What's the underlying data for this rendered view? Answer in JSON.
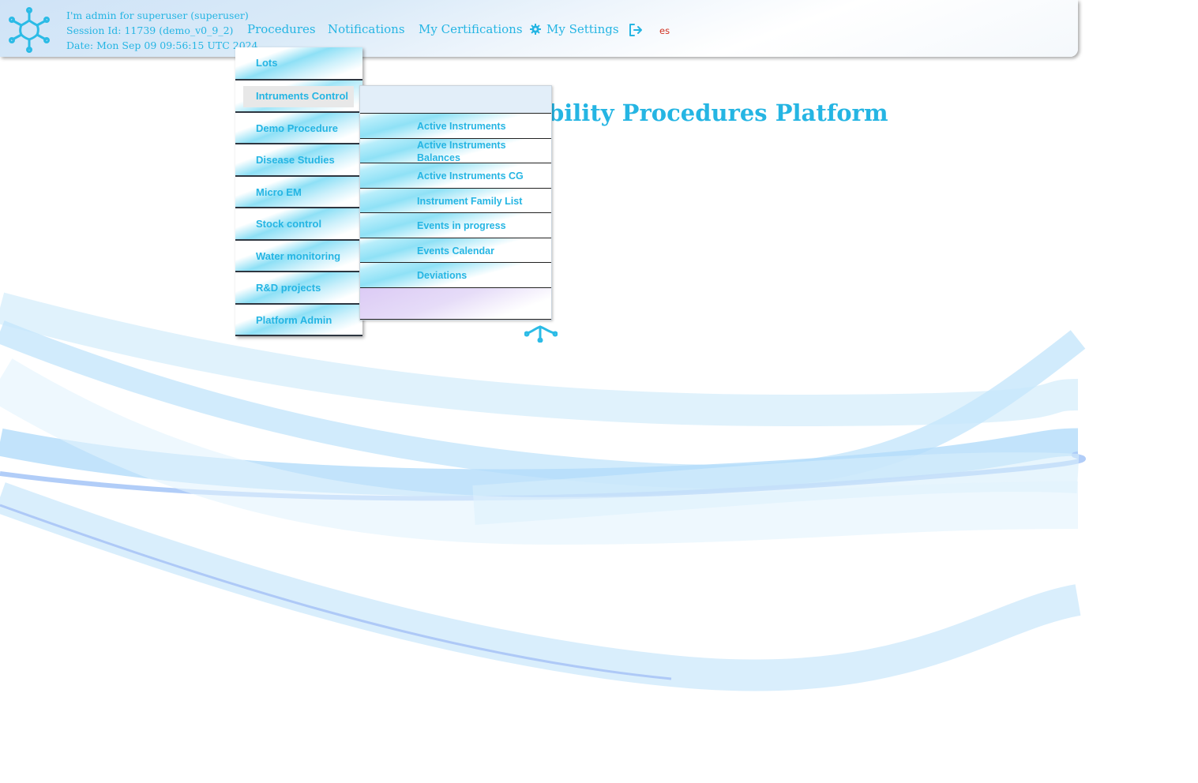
{
  "header": {
    "user_line": "I'm admin for superuser (superuser)",
    "session_line": "Session Id: 11739 (demo_v0_9_2)",
    "date_line": "Date: Mon Sep 09 09:56:15 UTC 2024",
    "nav": {
      "procedures": "Procedures",
      "notifications": "Notifications",
      "certifications": "My Certifications",
      "settings": "My Settings"
    },
    "language": "es"
  },
  "main": {
    "title": "bility Procedures Platform"
  },
  "procedures_menu": {
    "items": [
      {
        "label": "Lots"
      },
      {
        "label": "Intruments Control"
      },
      {
        "label": "Demo Procedure"
      },
      {
        "label": "Disease Studies"
      },
      {
        "label": "Micro EM"
      },
      {
        "label": "Stock control"
      },
      {
        "label": "Water monitoring"
      },
      {
        "label": "R&D projects"
      },
      {
        "label": "Platform Admin"
      }
    ],
    "active_item": "Intruments Control"
  },
  "instruments_submenu": {
    "items": [
      {
        "label": "Active Instruments"
      },
      {
        "label": "Active Instruments Balances"
      },
      {
        "label": "Active Instruments CG"
      },
      {
        "label": "Instrument Family List"
      },
      {
        "label": "Events in progress"
      },
      {
        "label": "Events Calendar"
      },
      {
        "label": "Deviations"
      }
    ]
  },
  "colors": {
    "accent": "#25b5e3",
    "language_link": "#d03020",
    "menu_divider": "#2e3640"
  },
  "icons": [
    "app-logo-icon",
    "gear-icon",
    "logout-icon"
  ]
}
